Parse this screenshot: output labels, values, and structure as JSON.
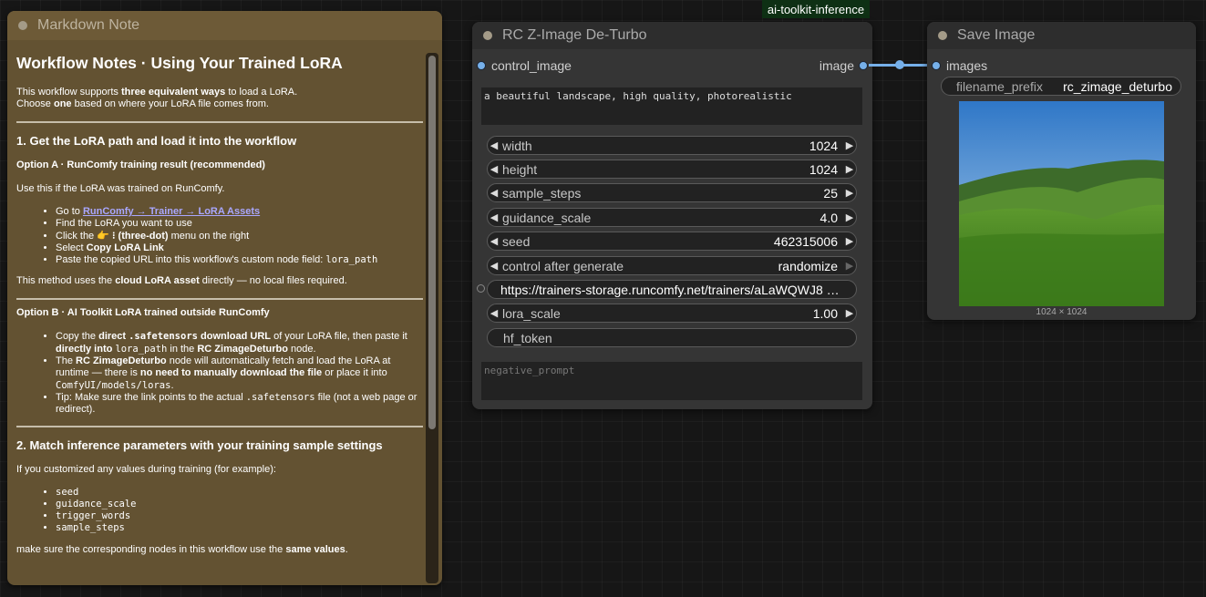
{
  "group_label": "ai-toolkit-inference",
  "markdown_note": {
    "title": "Markdown Note",
    "heading": "Workflow Notes · Using Your Trained LoRA",
    "intro": {
      "t1": "This workflow supports ",
      "b1": "three equivalent ways",
      "t2": " to load a LoRA.",
      "t3": "Choose ",
      "b2": "one",
      "t4": " based on where your LoRA file comes from."
    },
    "section1": {
      "heading": "1. Get the LoRA path and load it into the workflow",
      "option_a_title": "Option A · RunComfy training result (recommended)",
      "option_a_desc": "Use this if the LoRA was trained on RunComfy.",
      "steps": {
        "s1_pre": "Go to ",
        "s1_link": "RunComfy → Trainer → LoRA Assets",
        "s2": "Find the LoRA you want to use",
        "s3_pre": "Click the 👉 ",
        "s3_b": "⁝ (three-dot)",
        "s3_post": " menu on the right",
        "s4_pre": "Select ",
        "s4_b": "Copy LoRA Link",
        "s5_pre": "Paste the copied URL into this workflow's custom node field: ",
        "s5_code": "lora_path"
      },
      "method_note": {
        "t1": "This method uses the ",
        "b1": "cloud LoRA asset",
        "t2": " directly — no local files required."
      },
      "option_b_title": "Option B · AI Toolkit LoRA trained outside RunComfy",
      "option_b": {
        "l1_t1": "Copy the ",
        "l1_b1": "direct ",
        "l1_c1": ".safetensors",
        "l1_b2": " download URL",
        "l1_t2": " of your LoRA file, then paste it ",
        "l1_b3": "directly into",
        "l1_t3": " ",
        "l1_c2": "lora_path",
        "l1_t4": " in the ",
        "l1_b4": "RC ZimageDeturbo",
        "l1_t5": " node.",
        "l2_t1": "The ",
        "l2_b1": "RC ZimageDeturbo",
        "l2_t2": " node will automatically fetch and load the LoRA at runtime — there is ",
        "l2_b2": "no need to manually download the file",
        "l2_t3": " or place it into ",
        "l2_c1": "ComfyUI/models/loras",
        "l2_t4": ".",
        "l3_t1": "Tip: Make sure the link points to the actual ",
        "l3_c1": ".safetensors",
        "l3_t2": " file (not a web page or redirect)."
      }
    },
    "section2": {
      "heading": "2. Match inference parameters with your training sample settings",
      "intro": "If you customized any values during training (for example):",
      "items": [
        "seed",
        "guidance_scale",
        "trigger_words",
        "sample_steps"
      ],
      "outro_t1": "make sure the corresponding nodes in this workflow use the ",
      "outro_b1": "same values",
      "outro_t2": "."
    }
  },
  "rc_node": {
    "title": "RC Z-Image De-Turbo",
    "input_label": "control_image",
    "output_label": "image",
    "prompt": "a beautiful landscape, high quality, photorealistic",
    "widgets": {
      "width": {
        "label": "width",
        "value": "1024"
      },
      "height": {
        "label": "height",
        "value": "1024"
      },
      "sample_steps": {
        "label": "sample_steps",
        "value": "25"
      },
      "guidance_scale": {
        "label": "guidance_scale",
        "value": "4.0"
      },
      "seed": {
        "label": "seed",
        "value": "462315006"
      },
      "control_after_generate": {
        "label": "control after generate",
        "value": "randomize"
      },
      "lora_path": {
        "value": "https://trainers-storage.runcomfy.net/trainers/aLaWQWJ8 …"
      },
      "lora_scale": {
        "label": "lora_scale",
        "value": "1.00"
      },
      "hf_token": {
        "label": "hf_token"
      }
    },
    "negative_placeholder": "negative_prompt"
  },
  "save_node": {
    "title": "Save Image",
    "input_label": "images",
    "filename_prefix_label": "filename_prefix",
    "filename_prefix_value": "rc_zimage_deturbo",
    "image_size": "1024 × 1024"
  },
  "colors": {
    "link": "#76b0ea",
    "note_bg": "#635232",
    "node_bg": "#353535",
    "canvas": "#161616"
  }
}
